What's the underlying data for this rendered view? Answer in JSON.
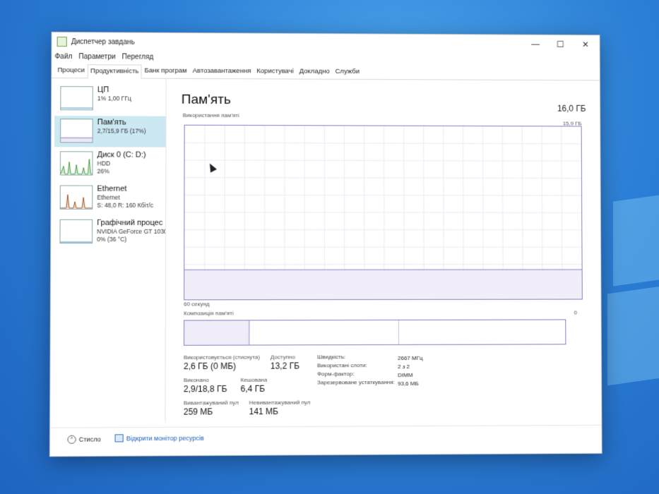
{
  "window": {
    "title": "Диспетчер завдань"
  },
  "menu": [
    "Файл",
    "Параметри",
    "Перегляд"
  ],
  "tabs": [
    "Процеси",
    "Продуктивність",
    "Банк програм",
    "Автозавантаження",
    "Користувачі",
    "Докладно",
    "Служби"
  ],
  "active_tab_index": 1,
  "sidebar": [
    {
      "title": "ЦП",
      "line1": "1% 1,00 ГГц",
      "line2": ""
    },
    {
      "title": "Пам'ять",
      "line1": "2,7/15,9 ГБ (17%)",
      "line2": ""
    },
    {
      "title": "Диск 0 (C: D:)",
      "line1": "HDD",
      "line2": "26%"
    },
    {
      "title": "Ethernet",
      "line1": "Ethernet",
      "line2": "S: 48,0 R: 160 Кбіт/с"
    },
    {
      "title": "Графічний процес",
      "line1": "NVIDIA GeForce GT 1030",
      "line2": "0% (36 °C)"
    }
  ],
  "selected_sidebar_index": 1,
  "main": {
    "title": "Пам'ять",
    "total": "16,0 ГБ",
    "usage_label": "Використання пам'яті",
    "usage_max": "15,9 ГБ",
    "time_label": "60 секунд",
    "zero_label": "0",
    "composition_label": "Композиція пам'яті",
    "memory_in_use_fraction": 0.17
  },
  "stats": {
    "in_use_label": "Використовується (стиснута)",
    "in_use_value": "2,6 ГБ (0 МБ)",
    "available_label": "Доступно",
    "available_value": "13,2 ГБ",
    "committed_label": "Виконано",
    "committed_value": "2,9/18,8 ГБ",
    "cached_label": "Кешована",
    "cached_value": "6,4 ГБ",
    "paged_label": "Вивантажуваний пул",
    "paged_value": "259 МБ",
    "nonpaged_label": "Невивантажуваний пул",
    "nonpaged_value": "141 МБ"
  },
  "info": [
    {
      "label": "Швидкість:",
      "value": "2667 МГц"
    },
    {
      "label": "Використані слоти:",
      "value": "2 з 2"
    },
    {
      "label": "Форм-фактор:",
      "value": "DIMM"
    },
    {
      "label": "Зарезервоване устаткування:",
      "value": "93,6 МБ"
    }
  ],
  "footer": {
    "fewer": "Стисло",
    "resmon": "Відкрити монітор ресурсів"
  },
  "colors": {
    "memory_line": "#8b7ec6",
    "selected": "#cce8f3",
    "cpu_line": "#4a90c6",
    "disk_line": "#4aa04a",
    "net_line": "#a05a2c"
  }
}
